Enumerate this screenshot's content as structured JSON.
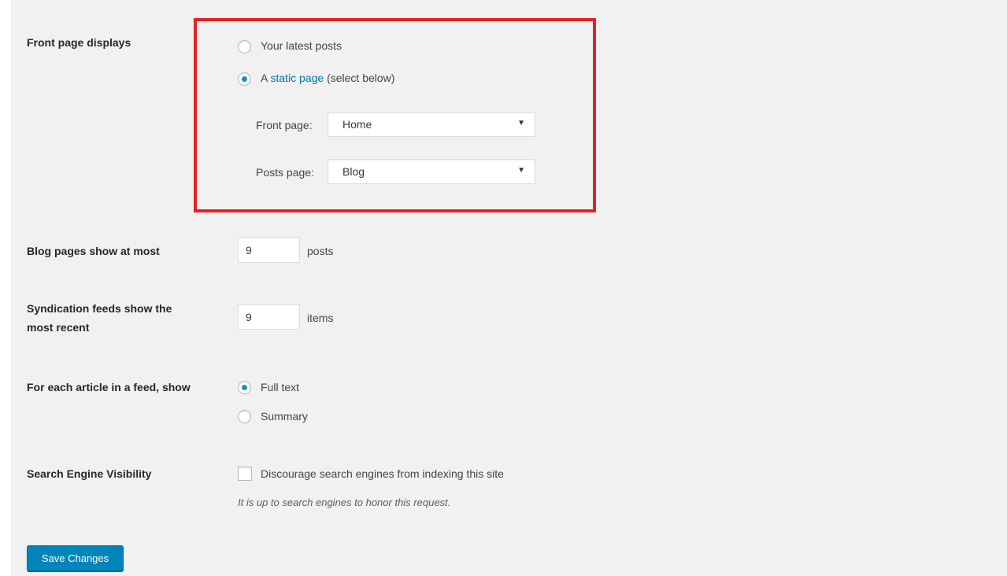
{
  "front_page": {
    "label": "Front page displays",
    "option_latest": "Your latest posts",
    "option_static_prefix": "A",
    "option_static_link": "static page",
    "option_static_suffix": "(select below)",
    "selected": "static",
    "front_page_label": "Front page:",
    "front_page_value": "Home",
    "posts_page_label": "Posts page:",
    "posts_page_value": "Blog",
    "caret": "▼"
  },
  "blog_pages": {
    "label": "Blog pages show at most",
    "value": "9",
    "unit": "posts"
  },
  "syndication": {
    "label_line1": "Syndication feeds show the",
    "label_line2": "most recent",
    "value": "9",
    "unit": "items"
  },
  "feed_article": {
    "label": "For each article in a feed, show",
    "option_full": "Full text",
    "option_summary": "Summary",
    "selected": "full"
  },
  "search_visibility": {
    "label": "Search Engine Visibility",
    "checkbox_label": "Discourage search engines from indexing this site",
    "checked": false,
    "hint": "It is up to search engines to honor this request."
  },
  "save_button": "Save Changes",
  "colors": {
    "accent": "#0073aa",
    "button": "#0085ba",
    "highlight_border": "#e32227",
    "background": "#f1f1f1"
  }
}
